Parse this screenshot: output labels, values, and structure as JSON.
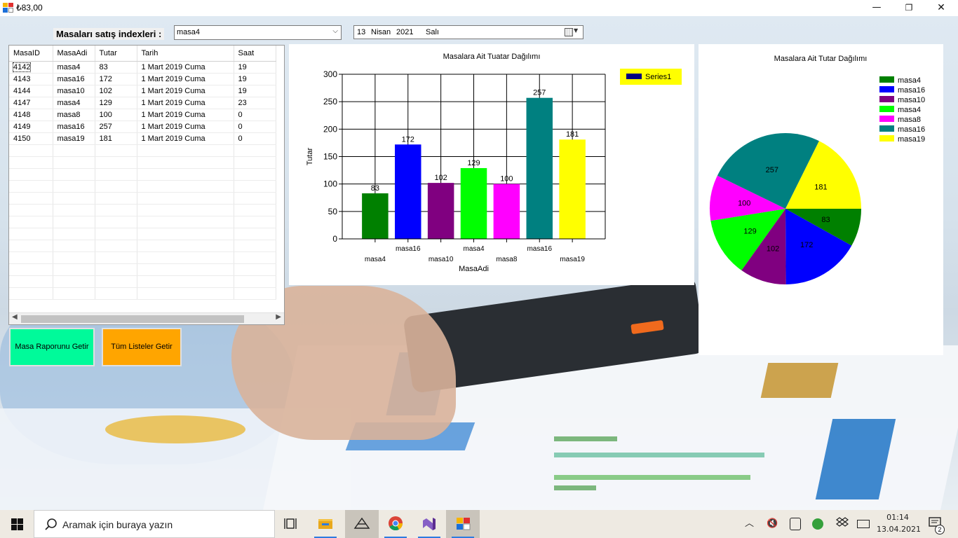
{
  "window": {
    "title": "₺83,00",
    "minimize_glyph": "—",
    "maximize_glyph": "❐",
    "close_glyph": "✕"
  },
  "filters": {
    "table_label": "Masaları satış indexleri  :",
    "table_value": "masa4",
    "date": {
      "day": "13",
      "month": "Nisan",
      "year": "2021",
      "weekday": "Salı"
    }
  },
  "grid": {
    "columns": [
      "MasaID",
      "MasaAdi",
      "Tutar",
      "Tarih",
      "Saat"
    ],
    "rows": [
      [
        "4142",
        "masa4",
        "83",
        "1 Mart 2019 Cuma",
        "19"
      ],
      [
        "4143",
        "masa16",
        "172",
        "1 Mart 2019 Cuma",
        "19"
      ],
      [
        "4144",
        "masa10",
        "102",
        "1 Mart 2019 Cuma",
        "19"
      ],
      [
        "4147",
        "masa4",
        "129",
        "1 Mart 2019 Cuma",
        "23"
      ],
      [
        "4148",
        "masa8",
        "100",
        "1 Mart 2019 Cuma",
        "0"
      ],
      [
        "4149",
        "masa16",
        "257",
        "1 Mart 2019 Cuma",
        "0"
      ],
      [
        "4150",
        "masa19",
        "181",
        "1 Mart 2019 Cuma",
        "0"
      ]
    ],
    "selected_row": 0
  },
  "buttons": {
    "report": "Masa Raporunu Getir",
    "all_lists": "Tüm Listeler Getir"
  },
  "chart_data": [
    {
      "type": "bar",
      "title": "Masalara Ait Tuatar Dağılımı",
      "xlabel": "MasaAdi",
      "ylabel": "Tutar",
      "categories": [
        "masa4",
        "masa16",
        "masa10",
        "masa4",
        "masa8",
        "masa16",
        "masa19"
      ],
      "series": [
        {
          "name": "Series1",
          "values": [
            83,
            172,
            102,
            129,
            100,
            257,
            181
          ]
        }
      ],
      "colors": [
        "#008000",
        "#0000ff",
        "#800080",
        "#00ff00",
        "#ff00ff",
        "#008080",
        "#ffff00"
      ],
      "ylim": [
        0,
        300
      ],
      "yticks": [
        0,
        50,
        100,
        150,
        200,
        250,
        300
      ],
      "grid": true,
      "legend": "top-right",
      "legend_color": "#ffff00",
      "legend_swatch": "#000080"
    },
    {
      "type": "pie",
      "title": "Masalara Ait Tutar Dağılımı",
      "labels": [
        "masa4",
        "masa16",
        "masa10",
        "masa4",
        "masa8",
        "masa16",
        "masa19"
      ],
      "values": [
        83,
        172,
        102,
        129,
        100,
        257,
        181
      ],
      "colors": [
        "#008000",
        "#0000ff",
        "#800080",
        "#00ff00",
        "#ff00ff",
        "#008080",
        "#ffff00"
      ],
      "legend": "top-right"
    }
  ],
  "taskbar": {
    "search_placeholder": "Aramak için buraya yazın",
    "apps": [
      "task-view",
      "file-explorer",
      "app-pinned-active",
      "chrome",
      "visual-studio",
      "windows-form-app"
    ],
    "tray_chevron": "︿",
    "tray_volume": "🔇",
    "clock_time": "01:14",
    "clock_date": "13.04.2021",
    "notification_count": "2"
  }
}
